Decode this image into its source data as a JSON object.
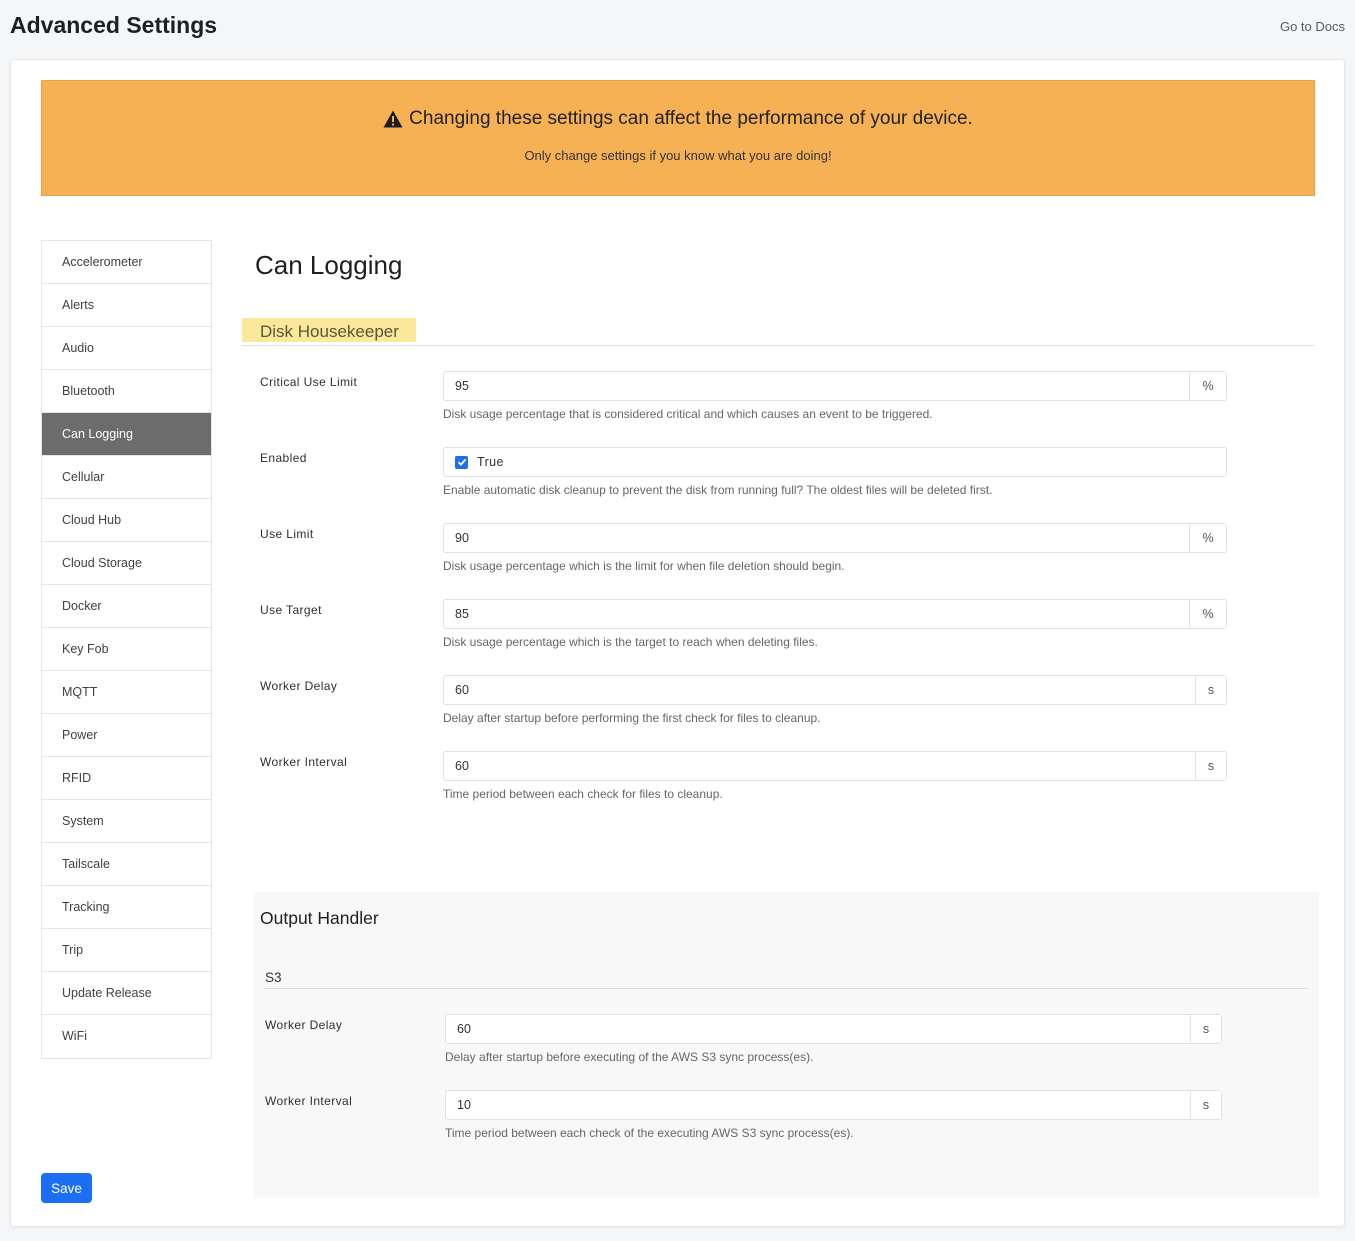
{
  "header": {
    "title": "Advanced Settings",
    "docs_link": "Go to Docs"
  },
  "warning": {
    "title": "Changing these settings can affect the performance of your device.",
    "subtitle": "Only change settings if you know what you are doing!",
    "icon": "warning-triangle-icon"
  },
  "sidebar": {
    "items": [
      {
        "label": "Accelerometer"
      },
      {
        "label": "Alerts"
      },
      {
        "label": "Audio"
      },
      {
        "label": "Bluetooth"
      },
      {
        "label": "Can Logging",
        "active": true
      },
      {
        "label": "Cellular"
      },
      {
        "label": "Cloud Hub"
      },
      {
        "label": "Cloud Storage"
      },
      {
        "label": "Docker"
      },
      {
        "label": "Key Fob"
      },
      {
        "label": "MQTT"
      },
      {
        "label": "Power"
      },
      {
        "label": "RFID"
      },
      {
        "label": "System"
      },
      {
        "label": "Tailscale"
      },
      {
        "label": "Tracking"
      },
      {
        "label": "Trip"
      },
      {
        "label": "Update Release"
      },
      {
        "label": "WiFi"
      }
    ]
  },
  "main": {
    "title": "Can Logging",
    "disk_housekeeper": {
      "heading": "Disk Housekeeper",
      "fields": [
        {
          "label": "Critical Use Limit",
          "value": "95",
          "unit": "%",
          "help": "Disk usage percentage that is considered critical and which causes an event to be triggered."
        },
        {
          "label": "Enabled",
          "value": "True",
          "checked": true,
          "help": "Enable automatic disk cleanup to prevent the disk from running full? The oldest files will be deleted first."
        },
        {
          "label": "Use Limit",
          "value": "90",
          "unit": "%",
          "help": "Disk usage percentage which is the limit for when file deletion should begin."
        },
        {
          "label": "Use Target",
          "value": "85",
          "unit": "%",
          "help": "Disk usage percentage which is the target to reach when deleting files."
        },
        {
          "label": "Worker Delay",
          "value": "60",
          "unit": "s",
          "help": "Delay after startup before performing the first check for files to cleanup."
        },
        {
          "label": "Worker Interval",
          "value": "60",
          "unit": "s",
          "help": "Time period between each check for files to cleanup."
        }
      ]
    },
    "output_handler": {
      "heading": "Output Handler",
      "subheading": "S3",
      "fields": [
        {
          "label": "Worker Delay",
          "value": "60",
          "unit": "s",
          "help": "Delay after startup before executing of the AWS S3 sync process(es)."
        },
        {
          "label": "Worker Interval",
          "value": "10",
          "unit": "s",
          "help": "Time period between each check of the executing AWS S3 sync process(es)."
        }
      ]
    }
  },
  "footer": {
    "save_label": "Save"
  },
  "colors": {
    "warning_bg": "#f7b155",
    "active_nav": "#6c6c6c",
    "primary": "#1c6ef2",
    "highlight": "#fbe89a"
  }
}
